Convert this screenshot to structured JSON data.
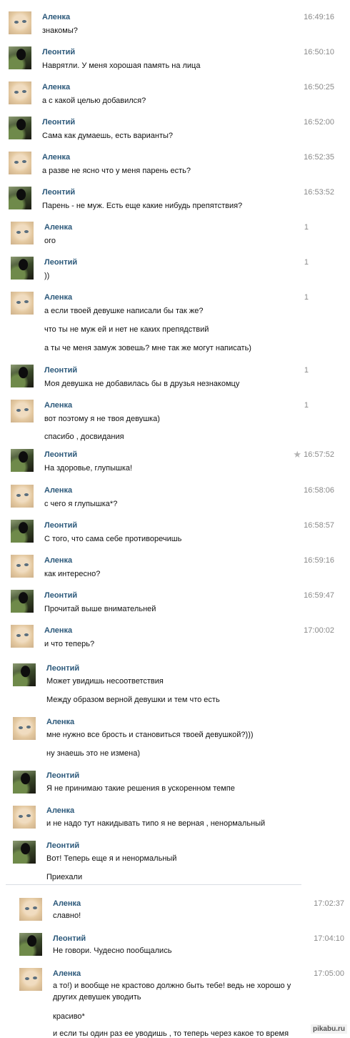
{
  "messages": [
    {
      "author": "Аленка",
      "time": "16:49:16",
      "lines": [
        "знакомы?"
      ]
    },
    {
      "author": "Леонтий",
      "time": "16:50:10",
      "lines": [
        "Наврятли. У меня хорошая память на лица"
      ]
    },
    {
      "author": "Аленка",
      "time": "16:50:25",
      "lines": [
        "а с какой целью добавился?"
      ]
    },
    {
      "author": "Леонтий",
      "time": "16:52:00",
      "lines": [
        "Сама как думаешь, есть варианты?"
      ]
    },
    {
      "author": "Аленка",
      "time": "16:52:35",
      "lines": [
        "а разве не ясно что у меня парень есть?"
      ]
    },
    {
      "author": "Леонтий",
      "time": "16:53:52",
      "lines": [
        "Парень - не муж. Есть еще какие нибудь препятствия?"
      ]
    },
    {
      "author": "Аленка",
      "time": "1",
      "lines": [
        "ого"
      ]
    },
    {
      "author": "Леонтий",
      "time": "1",
      "lines": [
        "))"
      ]
    },
    {
      "author": "Аленка",
      "time": "1",
      "lines": [
        "а если твоей девушке написали бы так же?",
        "что ты не муж ей и нет не каких препядствий",
        "а ты че меня замуж зовешь? мне так же могут написать)"
      ]
    },
    {
      "author": "Леонтий",
      "time": "1",
      "lines": [
        "Моя девушка не добавилась бы в друзья незнакомцу"
      ]
    },
    {
      "author": "Аленка",
      "time": "1",
      "lines": [
        "вот поэтому я не твоя девушка)",
        "спасибо , досвидания"
      ]
    },
    {
      "author": "Леонтий",
      "time": "16:57:52",
      "lines": [
        "На здоровье, глупышка!"
      ]
    },
    {
      "author": "Аленка",
      "time": "16:58:06",
      "lines": [
        "с чего я глупышка*?"
      ]
    },
    {
      "author": "Леонтий",
      "time": "16:58:57",
      "lines": [
        "С того, что сама себе противоречишь"
      ]
    },
    {
      "author": "Аленка",
      "time": "16:59:16",
      "lines": [
        "как интересно?"
      ]
    },
    {
      "author": "Леонтий",
      "time": "16:59:47",
      "lines": [
        "Прочитай выше внимательней"
      ]
    },
    {
      "author": "Аленка",
      "time": "17:00:02",
      "lines": [
        "и что теперь?"
      ]
    },
    {
      "author": "Леонтий",
      "time": "",
      "lines": [
        "Может увидишь несоответствия",
        "Между образом верной девушки и тем что есть"
      ]
    },
    {
      "author": "Аленка",
      "time": "",
      "lines": [
        "мне нужно все брость и становиться твоей девушкой?)))",
        "ну знаешь это не измена)"
      ]
    },
    {
      "author": "Леонтий",
      "time": "",
      "lines": [
        "Я не принимаю такие решения в ускоренном темпе"
      ]
    },
    {
      "author": "Аленка",
      "time": "",
      "lines": [
        "и не надо тут накидывать типо я не верная , ненормальный"
      ]
    },
    {
      "author": "Леонтий",
      "time": "",
      "lines": [
        "Вот! Теперь еще я и ненормальный",
        "Приехали"
      ]
    },
    {
      "author": "Аленка",
      "time": "17:02:37",
      "lines": [
        "славно!"
      ]
    },
    {
      "author": "Леонтий",
      "time": "17:04:10",
      "lines": [
        "Не говори. Чудесно пообщались"
      ]
    },
    {
      "author": "Аленка",
      "time": "17:05:00",
      "lines": [
        "а то!) и вообще не крастово должно быть тебе! ведь не хорошо у",
        "других девушек уводить",
        "красиво*",
        "и если ты один раз ее уводишь , то теперь через какое то время"
      ]
    }
  ],
  "watermark": "pikabu.ru",
  "colors": {
    "author": "#2b587a",
    "time": "#8a8a8a",
    "text": "#111111",
    "separator": "#d8dde3"
  },
  "icons": {
    "favorite": "star-icon"
  }
}
